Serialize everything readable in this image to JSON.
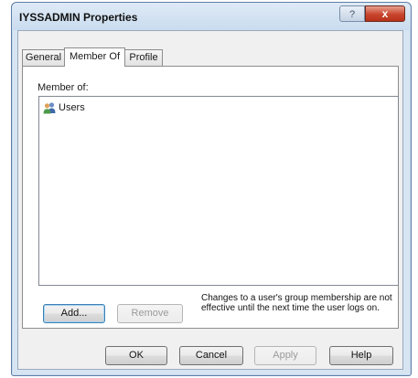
{
  "window": {
    "title": "IYSSADMIN Properties",
    "help_glyph": "?",
    "close_glyph": "x"
  },
  "tabs": [
    {
      "label": "General",
      "active": false
    },
    {
      "label": "Member Of",
      "active": true
    },
    {
      "label": "Profile",
      "active": false
    }
  ],
  "member_of": {
    "label": "Member of:",
    "items": [
      {
        "label": "Users",
        "icon": "group-icon"
      }
    ]
  },
  "actions": {
    "add_label": "Add...",
    "remove_label": "Remove",
    "note": "Changes to a user's group membership are not effective until the next time the user logs on."
  },
  "footer": {
    "ok_label": "OK",
    "cancel_label": "Cancel",
    "apply_label": "Apply",
    "help_label": "Help"
  },
  "colors": {
    "accent": "#3c7fb1",
    "close_button": "#c8452c",
    "frame": "#d7e4f2"
  }
}
